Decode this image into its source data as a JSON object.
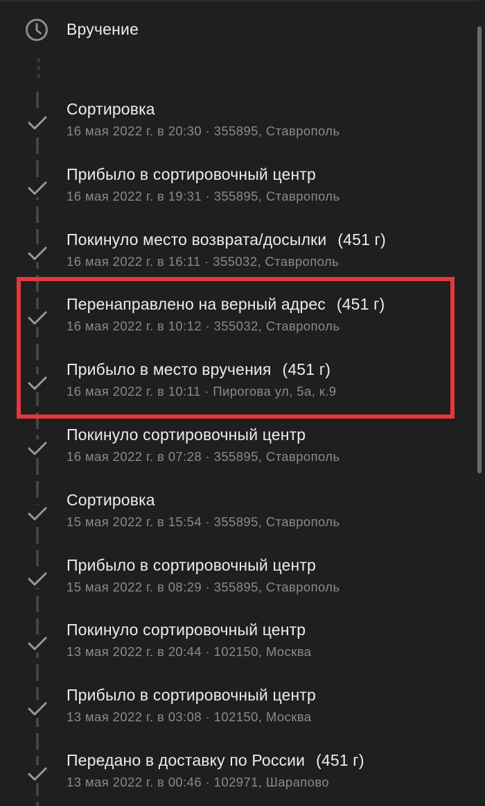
{
  "header": {
    "label": "Вручение",
    "icon": "clock-icon"
  },
  "events": [
    {
      "title": "Сортировка",
      "weight": "",
      "meta": "16 мая 2022 г. в 20:30 · 355895, Ставрополь"
    },
    {
      "title": "Прибыло в сортировочный центр",
      "weight": "",
      "meta": "16 мая 2022 г. в 19:31 · 355895, Ставрополь"
    },
    {
      "title": "Покинуло место возврата/досылки",
      "weight": "(451 г)",
      "meta": "16 мая 2022 г. в 16:11 · 355032, Ставрополь"
    },
    {
      "title": "Перенаправлено на верный адрес",
      "weight": "(451 г)",
      "meta": "16 мая 2022 г. в 10:12 · 355032, Ставрополь"
    },
    {
      "title": "Прибыло в место вручения",
      "weight": "(451 г)",
      "meta": "16 мая 2022 г. в 10:11 · Пирогова ул, 5а, к.9"
    },
    {
      "title": "Покинуло сортировочный центр",
      "weight": "",
      "meta": "16 мая 2022 г. в 07:28 · 355895, Ставрополь"
    },
    {
      "title": "Сортировка",
      "weight": "",
      "meta": "15 мая 2022 г. в 15:54 · 355895, Ставрополь"
    },
    {
      "title": "Прибыло в сортировочный центр",
      "weight": "",
      "meta": "15 мая 2022 г. в 08:29 · 355895, Ставрополь"
    },
    {
      "title": "Покинуло сортировочный центр",
      "weight": "",
      "meta": "13 мая 2022 г. в 20:44 · 102150, Москва"
    },
    {
      "title": "Прибыло в сортировочный центр",
      "weight": "",
      "meta": "13 мая 2022 г. в 03:08 · 102150, Москва"
    },
    {
      "title": "Передано в доставку по России",
      "weight": "(451 г)",
      "meta": "13 мая 2022 г. в 00:46 · 102971, Шарапово"
    }
  ],
  "colors": {
    "background": "#1f1f1f",
    "title": "#ececec",
    "meta": "#8a8a8a",
    "timeline": "#454545",
    "check": "#9a9a9a",
    "highlight": "#e5373c"
  }
}
